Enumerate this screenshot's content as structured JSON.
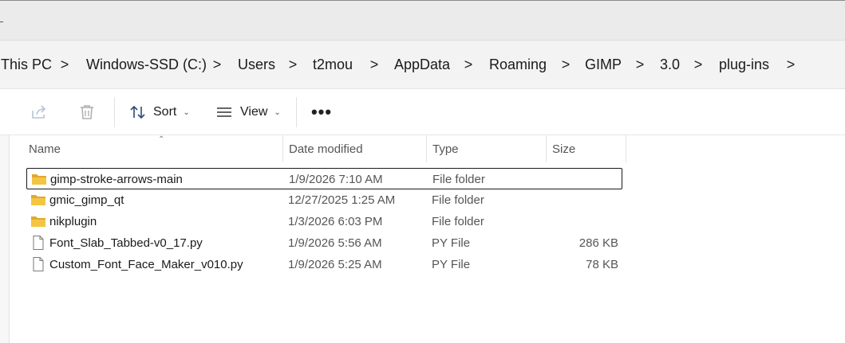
{
  "breadcrumb": [
    "This PC",
    "Windows-SSD (C:)",
    "Users",
    "t2mou",
    "AppData",
    "Roaming",
    "GIMP",
    "3.0",
    "plug-ins"
  ],
  "breadcrumb_separator": ">",
  "toolbar": {
    "sort_label": "Sort",
    "view_label": "View",
    "more_label": "•••"
  },
  "columns": {
    "name": "Name",
    "date": "Date modified",
    "type": "Type",
    "size": "Size"
  },
  "files": [
    {
      "name": "gimp-stroke-arrows-main",
      "date": "1/9/2026 7:10 AM",
      "type": "File folder",
      "size": "",
      "icon": "folder-icon",
      "selected": true
    },
    {
      "name": "gmic_gimp_qt",
      "date": "12/27/2025 1:25 AM",
      "type": "File folder",
      "size": "",
      "icon": "folder-icon",
      "selected": false
    },
    {
      "name": "nikplugin",
      "date": "1/3/2026 6:03 PM",
      "type": "File folder",
      "size": "",
      "icon": "folder-icon",
      "selected": false
    },
    {
      "name": "Font_Slab_Tabbed-v0_17.py",
      "date": "1/9/2026 5:56 AM",
      "type": "PY File",
      "size": "286 KB",
      "icon": "file-icon",
      "selected": false
    },
    {
      "name": "Custom_Font_Face_Maker_v010.py",
      "date": "1/9/2026 5:25 AM",
      "type": "PY File",
      "size": "78 KB",
      "icon": "file-icon",
      "selected": false
    }
  ],
  "colors": {
    "folder": "#f4c542",
    "folder_dark": "#e0a82e",
    "selection_border": "#1a1a1a"
  }
}
